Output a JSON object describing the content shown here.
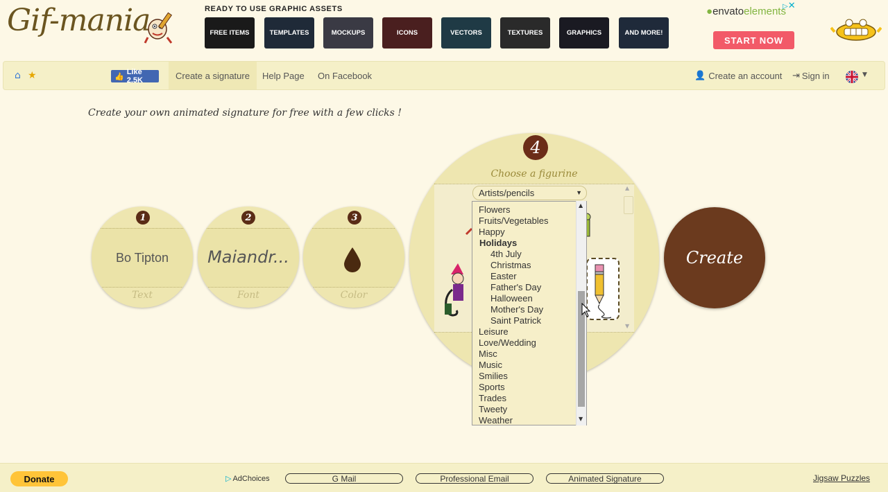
{
  "site": {
    "logo_text": "Gif-mania"
  },
  "ad": {
    "heading": "READY TO USE GRAPHIC ASSETS",
    "tiles": [
      {
        "label": "FREE ITEMS",
        "color": "#1a1a1a"
      },
      {
        "label": "TEMPLATES",
        "color": "#1f2a38"
      },
      {
        "label": "MOCKUPS",
        "color": "#3a3a44"
      },
      {
        "label": "ICONS",
        "color": "#4a1f1f"
      },
      {
        "label": "VECTORS",
        "color": "#1f3a45"
      },
      {
        "label": "TEXTURES",
        "color": "#2a2a2a"
      },
      {
        "label": "GRAPHICS",
        "color": "#1a1a22"
      },
      {
        "label": "AND MORE!",
        "color": "#1f2a3a"
      }
    ],
    "brand_main": "envato",
    "brand_suffix": "elements",
    "cta": "START NOW",
    "close": "✕"
  },
  "nav": {
    "fb_like": "Like 2.5K",
    "links": [
      "Create a signature",
      "Help Page",
      "On Facebook"
    ],
    "create_account": "Create an account",
    "sign_in": "Sign in"
  },
  "main": {
    "intro": "Create your own animated signature for free with a few clicks !",
    "steps": [
      {
        "number": "1",
        "value": "Bo Tipton",
        "caption": "Text"
      },
      {
        "number": "2",
        "value": "Maiandr...",
        "caption": "Font"
      },
      {
        "number": "3",
        "value": "",
        "caption": "Color"
      }
    ],
    "figurine": {
      "number": "4",
      "label": "Choose a figurine",
      "selected": "Artists/pencils"
    },
    "create_label": "Create"
  },
  "dropdown": {
    "items": [
      {
        "text": "Flowers",
        "kind": "item"
      },
      {
        "text": "Fruits/Vegetables",
        "kind": "item"
      },
      {
        "text": "Happy",
        "kind": "item"
      },
      {
        "text": "Holidays",
        "kind": "group"
      },
      {
        "text": "4th July",
        "kind": "sub"
      },
      {
        "text": "Christmas",
        "kind": "sub"
      },
      {
        "text": "Easter",
        "kind": "sub"
      },
      {
        "text": "Father's Day",
        "kind": "sub"
      },
      {
        "text": "Halloween",
        "kind": "sub"
      },
      {
        "text": "Mother's Day",
        "kind": "sub"
      },
      {
        "text": "Saint Patrick",
        "kind": "sub"
      },
      {
        "text": "Leisure",
        "kind": "item"
      },
      {
        "text": "Love/Wedding",
        "kind": "item"
      },
      {
        "text": "Misc",
        "kind": "item"
      },
      {
        "text": "Music",
        "kind": "item"
      },
      {
        "text": "Smilies",
        "kind": "item"
      },
      {
        "text": "Sports",
        "kind": "item"
      },
      {
        "text": "Trades",
        "kind": "item"
      },
      {
        "text": "Tweety",
        "kind": "item"
      },
      {
        "text": "Weather",
        "kind": "item"
      }
    ]
  },
  "footer": {
    "donate": "Donate",
    "adchoices": "AdChoices",
    "links": [
      "G Mail",
      "Professional Email",
      "Animated Signature"
    ],
    "jigsaw": "Jigsaw Puzzles"
  },
  "colors": {
    "background": "#fdf8e6",
    "circle": "#eee6b0",
    "badge": "#5a2c16",
    "create_button": "#6b3a1e",
    "cta": "#f25a68"
  }
}
